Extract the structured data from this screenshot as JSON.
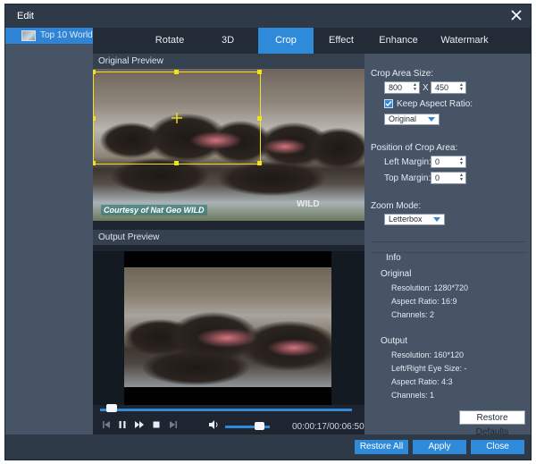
{
  "window": {
    "title": "Edit"
  },
  "file_list": {
    "items": [
      {
        "label": "Top 10 World"
      }
    ]
  },
  "tabs": [
    {
      "label": "Rotate",
      "active": false
    },
    {
      "label": "3D",
      "active": false
    },
    {
      "label": "Crop",
      "active": true
    },
    {
      "label": "Effect",
      "active": false
    },
    {
      "label": "Enhance",
      "active": false
    },
    {
      "label": "Watermark",
      "active": false
    }
  ],
  "preview": {
    "original_label": "Original Preview",
    "output_label": "Output Preview",
    "courtesy_text": "Courtesy of Nat Geo WILD",
    "watermark_text": "WILD"
  },
  "player": {
    "time_current": "00:00:17",
    "time_total": "00:06:50",
    "time_display": "00:00:17/00:06:50",
    "progress_fraction": 0.04,
    "volume_fraction": 0.75
  },
  "crop": {
    "area_size_label": "Crop Area Size:",
    "width": "800",
    "separator": "X",
    "height": "450",
    "keep_aspect_label": "Keep Aspect Ratio:",
    "keep_aspect_checked": true,
    "aspect_option": "Original",
    "position_label": "Position of Crop Area:",
    "left_margin_label": "Left Margin:",
    "left_margin": "0",
    "top_margin_label": "Top Margin:",
    "top_margin": "0",
    "zoom_mode_label": "Zoom Mode:",
    "zoom_mode": "Letterbox"
  },
  "info": {
    "heading": "Info",
    "original_heading": "Original",
    "original_resolution": "Resolution: 1280*720",
    "original_aspect": "Aspect Ratio: 16:9",
    "original_channels": "Channels: 2",
    "output_heading": "Output",
    "output_resolution": "Resolution: 160*120",
    "output_eye_size": "Left/Right Eye Size: -",
    "output_aspect": "Aspect Ratio: 4:3",
    "output_channels": "Channels: 1"
  },
  "buttons": {
    "restore_defaults": "Restore Defaults",
    "restore_all": "Restore All",
    "apply": "Apply",
    "close": "Close"
  },
  "colors": {
    "accent": "#2f8ad9",
    "crop_frame": "#f1e21a",
    "panel": "#475466",
    "dark": "#1e2530"
  }
}
